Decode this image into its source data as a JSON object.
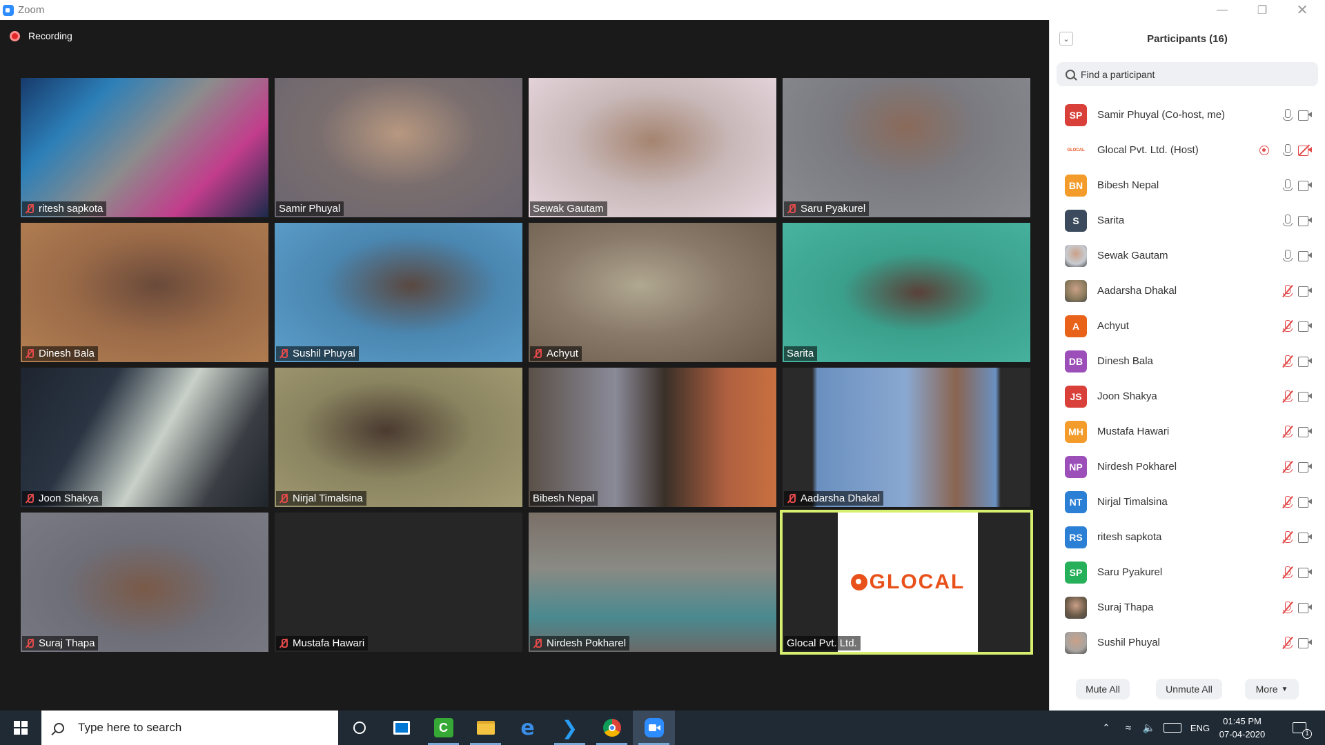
{
  "window": {
    "title": "Zoom"
  },
  "recording_label": "Recording",
  "tiles": [
    {
      "name": "ritesh sapkota",
      "muted": true,
      "bg": "linear-gradient(135deg,#173a6a 0%,#2c7fb8 25%,#8c8c8c 50%,#c23d8c 75%,#1a2a4a 100%)"
    },
    {
      "name": "Samir Phuyal",
      "muted": false,
      "bg": "radial-gradient(ellipse at 50% 40%,#b89880 0%,#7a6e6e 45%,#6a6570 100%)"
    },
    {
      "name": "Sewak Gautam",
      "muted": false,
      "bg": "radial-gradient(ellipse at 50% 45%,#a58470 0%,#c8b8b8 45%,#e8d8e0 100%)"
    },
    {
      "name": "Saru Pyakurel",
      "muted": true,
      "bg": "radial-gradient(ellipse at 50% 35%,#8a6a5a 0%,#7a7a80 40%,#8a8c92 100%)"
    },
    {
      "name": "Dinesh Bala",
      "muted": true,
      "bg": "radial-gradient(ellipse at 55% 45%,#6a4a3a 0%,#9a6a48 45%,#b48052 100%)"
    },
    {
      "name": "Sushil Phuyal",
      "muted": true,
      "bg": "radial-gradient(ellipse at 55% 45%,#5a4840 0%,#4a86b0 45%,#5ca0cc 100%)"
    },
    {
      "name": "Achyut",
      "muted": true,
      "bg": "radial-gradient(ellipse at 45% 45%,#b0a890 0%,#8a7a6a 45%,#6a5a4a 100%)"
    },
    {
      "name": "Sarita",
      "muted": false,
      "bg": "radial-gradient(ellipse at 55% 50%,#5a4038 0%,#3aa08c 40%,#48b4a0 100%)"
    },
    {
      "name": "Joon Shakya",
      "muted": true,
      "bg": "linear-gradient(120deg,#1e2530 0%,#2a3442 30%,#c8d0c8 55%,#3a3e44 80%,#20252c 100%)"
    },
    {
      "name": "Nirjal Timalsina",
      "muted": true,
      "bg": "radial-gradient(ellipse at 45% 45%,#4a3a30 0%,#8a8460 45%,#a49c74 100%)"
    },
    {
      "name": "Bibesh Nepal",
      "muted": false,
      "bg": "linear-gradient(90deg,#5a5048 0%,#8a8a98 35%,#3a3028 55%,#b06040 80%,#c87040 100%)"
    },
    {
      "name": "Aadarsha Dhakal",
      "muted": true,
      "bg": "linear-gradient(90deg,#2a2a2a 0%,#2a2a2a 12%,#6a90c0 14%,#8aa8d0 50%,#8a6450 70%,#6a90c0 86%,#2a2a2a 88%,#2a2a2a 100%)"
    },
    {
      "name": "Suraj Thapa",
      "muted": true,
      "bg": "radial-gradient(ellipse at 50% 55%,#7a5a48 0%,#6e6e78 45%,#7a7a84 100%)"
    },
    {
      "name": "Mustafa Hawari",
      "muted": true,
      "bg": "#262626"
    },
    {
      "name": "Nirdesh Pokharel",
      "muted": true,
      "bg": "linear-gradient(180deg,#7a7068 0%,#8a8a84 40%,#4a8a90 75%,#6a6a68 100%)"
    },
    {
      "name": "Glocal Pvt. Ltd.",
      "muted": false,
      "bg": "#262626",
      "logo": "GLOCAL",
      "active": true
    }
  ],
  "panel": {
    "title": "Participants (16)",
    "search_placeholder": "Find a participant",
    "participants": [
      {
        "name": "Samir Phuyal (Co-host, me)",
        "initials": "SP",
        "color": "#d9403a",
        "mic_muted": false,
        "cam_off": false
      },
      {
        "name": "Glocal Pvt. Ltd. (Host)",
        "initials": "GLOCAL",
        "color": "#ffffff",
        "mic_muted": false,
        "cam_off": true,
        "recording": true,
        "logo": true
      },
      {
        "name": "Bibesh Nepal",
        "initials": "BN",
        "color": "#f39c2b",
        "mic_muted": false,
        "cam_off": false
      },
      {
        "name": "Sarita",
        "initials": "S",
        "color": "#3b4a5c",
        "mic_muted": false,
        "cam_off": false
      },
      {
        "name": "Sewak Gautam",
        "initials": "",
        "color": "#c8ccd2",
        "mic_muted": false,
        "cam_off": false,
        "photo": true
      },
      {
        "name": "Aadarsha Dhakal",
        "initials": "",
        "color": "#8a7a5c",
        "mic_muted": true,
        "cam_off": false,
        "photo": true
      },
      {
        "name": "Achyut",
        "initials": "A",
        "color": "#e8621a",
        "mic_muted": true,
        "cam_off": false
      },
      {
        "name": "Dinesh Bala",
        "initials": "DB",
        "color": "#9c4fb8",
        "mic_muted": true,
        "cam_off": false
      },
      {
        "name": "Joon Shakya",
        "initials": "JS",
        "color": "#d9403a",
        "mic_muted": true,
        "cam_off": false
      },
      {
        "name": "Mustafa Hawari",
        "initials": "MH",
        "color": "#f39c2b",
        "mic_muted": true,
        "cam_off": false
      },
      {
        "name": "Nirdesh Pokharel",
        "initials": "NP",
        "color": "#9c4fb8",
        "mic_muted": true,
        "cam_off": false
      },
      {
        "name": "Nirjal Timalsina",
        "initials": "NT",
        "color": "#2b7fd4",
        "mic_muted": true,
        "cam_off": false
      },
      {
        "name": "ritesh sapkota",
        "initials": "RS",
        "color": "#2b7fd4",
        "mic_muted": true,
        "cam_off": false
      },
      {
        "name": "Saru Pyakurel",
        "initials": "SP",
        "color": "#27b05a",
        "mic_muted": true,
        "cam_off": false
      },
      {
        "name": "Suraj Thapa",
        "initials": "",
        "color": "#6a5a48",
        "mic_muted": true,
        "cam_off": false,
        "photo": true
      },
      {
        "name": "Sushil Phuyal",
        "initials": "",
        "color": "#a8a4a0",
        "mic_muted": true,
        "cam_off": false,
        "photo": true
      }
    ],
    "buttons": {
      "mute_all": "Mute All",
      "unmute_all": "Unmute All",
      "more": "More"
    }
  },
  "taskbar": {
    "search_placeholder": "Type here to search",
    "language": "ENG",
    "time": "01:45 PM",
    "date": "07-04-2020",
    "notification_count": "1"
  }
}
